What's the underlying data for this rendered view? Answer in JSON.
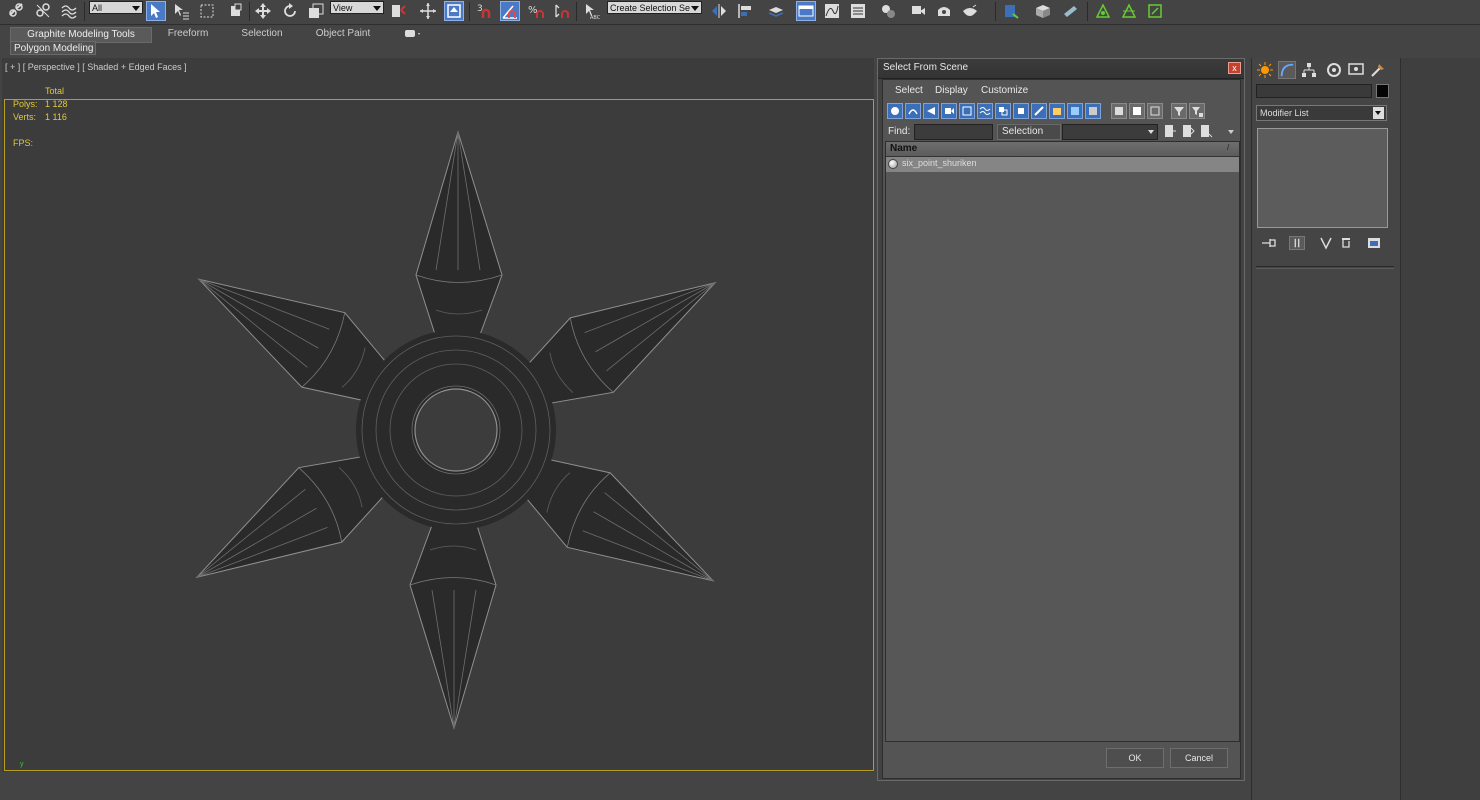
{
  "toolbar": {
    "filter_dropdown": "All",
    "ref_coord_dropdown": "View",
    "selection_set_dropdown": "Create Selection Se"
  },
  "ribbon": {
    "tabs": [
      "Graphite Modeling Tools",
      "Freeform",
      "Selection",
      "Object Paint"
    ],
    "panel_button": "Polygon Modeling"
  },
  "viewport": {
    "label": "[ + ] [ Perspective ] [ Shaded + Edged Faces ]",
    "stats_header": "Total",
    "polys_label": "Polys:",
    "polys_value": "1 128",
    "verts_label": "Verts:",
    "verts_value": "1 116",
    "fps_label": "FPS:"
  },
  "dialog": {
    "title": "Select From Scene",
    "close_glyph": "x",
    "menu": [
      "Select",
      "Display",
      "Customize"
    ],
    "find_label": "Find:",
    "find_value": "",
    "selection_set_label": "Selection Set:",
    "selection_set_value": "",
    "column_header": "Name",
    "objects": [
      {
        "name": "six_point_shuriken"
      }
    ],
    "ok_label": "OK",
    "cancel_label": "Cancel"
  },
  "command_panel": {
    "name_value": "",
    "modifier_list_label": "Modifier List"
  },
  "colors": {
    "accent": "#4a79c5",
    "viewport_border": "#b59e22",
    "stats_text": "#e3c838"
  }
}
